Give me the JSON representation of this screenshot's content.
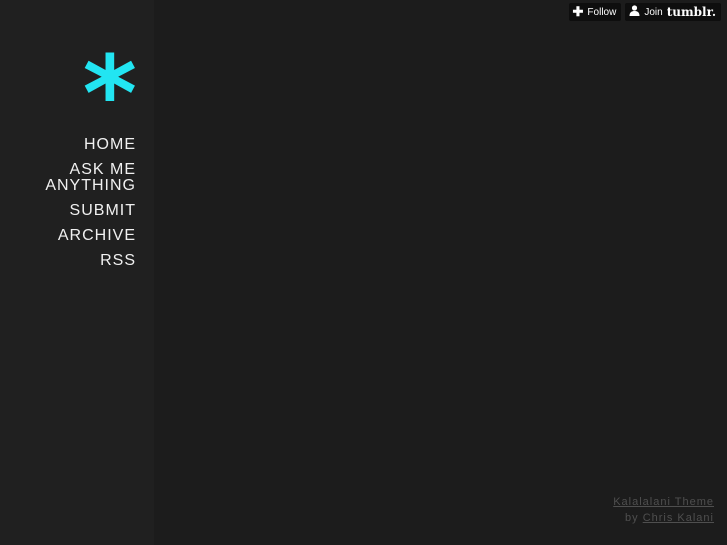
{
  "logo": {
    "glyph": "*",
    "color": "#22e5f2"
  },
  "nav": {
    "items": [
      {
        "label": "HOME"
      },
      {
        "label": "ASK ME ANYTHING"
      },
      {
        "label": "SUBMIT"
      },
      {
        "label": "ARCHIVE"
      },
      {
        "label": "RSS"
      }
    ]
  },
  "controls": {
    "follow": {
      "icon": "plus-icon",
      "label": "Follow"
    },
    "join": {
      "icon": "user-icon",
      "label": "Join",
      "brand": "tumblr."
    }
  },
  "footer": {
    "theme_link": "Kalalalani Theme",
    "by_text": "by",
    "author_link": "Chris Kalani"
  }
}
